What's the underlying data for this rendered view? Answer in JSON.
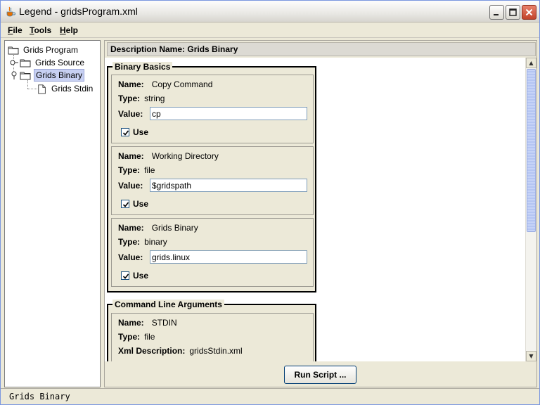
{
  "window": {
    "title": "Legend - gridsProgram.xml",
    "app_icon": "java-cup-icon"
  },
  "menu": {
    "file": "File",
    "tools": "Tools",
    "help": "Help"
  },
  "tree": {
    "root": "Grids Program",
    "items": [
      {
        "label": "Grids Source",
        "expanded": false
      },
      {
        "label": "Grids Binary",
        "expanded": true,
        "selected": true
      },
      {
        "label": "Grids Stdin",
        "leaf": true
      }
    ]
  },
  "header": {
    "description": "Description Name: Grids Binary"
  },
  "groups": [
    {
      "title": "Binary Basics",
      "params": [
        {
          "name_label": "Name:",
          "name": "Copy Command",
          "type_label": "Type:",
          "type": "string",
          "value_label": "Value:",
          "value": "cp",
          "use_label": "Use",
          "use": true
        },
        {
          "name_label": "Name:",
          "name": "Working Directory",
          "type_label": "Type:",
          "type": "file",
          "value_label": "Value:",
          "value": "$gridspath",
          "use_label": "Use",
          "use": true
        },
        {
          "name_label": "Name:",
          "name": "Grids Binary",
          "type_label": "Type:",
          "type": "binary",
          "value_label": "Value:",
          "value": "grids.linux",
          "use_label": "Use",
          "use": true
        }
      ]
    },
    {
      "title": "Command Line Arguments",
      "params": [
        {
          "name_label": "Name:",
          "name": "STDIN",
          "type_label": "Type:",
          "type": "file",
          "xml_label": "Xml Description:",
          "xml": "gridsStdin.xml"
        }
      ]
    }
  ],
  "footer": {
    "run_button": "Run Script ..."
  },
  "status": {
    "text": "Grids Binary"
  },
  "colors": {
    "selection": "#c7d0f2",
    "scroll_thumb": "#c6d3f7",
    "close_button": "#c2432a"
  }
}
